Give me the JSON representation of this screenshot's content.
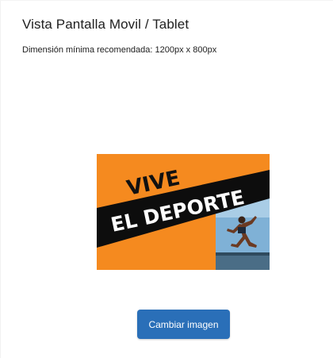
{
  "header": {
    "title": "Vista Pantalla Movil / Tablet",
    "subtitle": "Dimensión mínima recomendada: 1200px x 800px"
  },
  "preview": {
    "headline_top": "VIVE",
    "headline_bottom": "EL DEPORTE",
    "background_color": "#f58a1f",
    "band_color": "#0d0d0d",
    "icon": "runner-photo"
  },
  "actions": {
    "change_image_label": "Cambiar imagen",
    "button_color": "#2a6fb8"
  }
}
